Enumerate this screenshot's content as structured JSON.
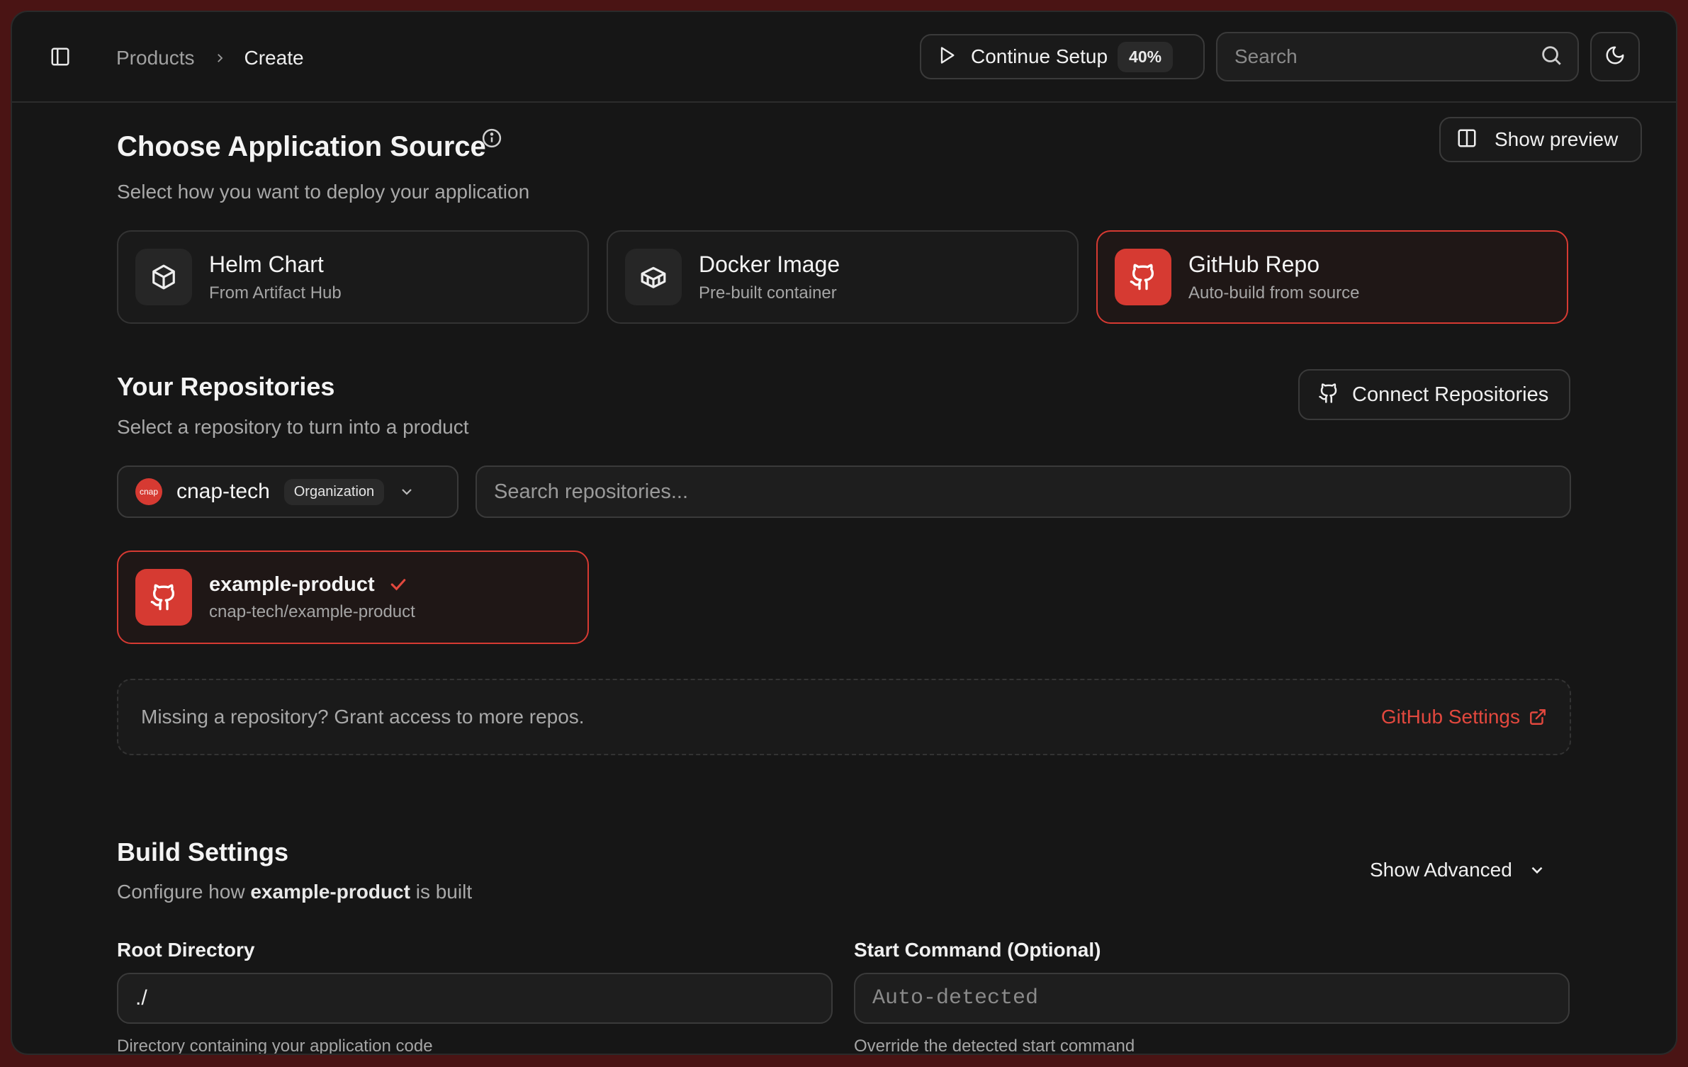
{
  "breadcrumb": {
    "parent": "Products",
    "current": "Create"
  },
  "header": {
    "continue_label": "Continue Setup",
    "continue_progress": "40%",
    "search_placeholder": "Search"
  },
  "source": {
    "title": "Choose Application Source",
    "subtitle": "Select how you want to deploy your application",
    "show_preview_label": "Show preview",
    "options": [
      {
        "title": "Helm Chart",
        "subtitle": "From Artifact Hub",
        "icon": "package-icon",
        "selected": false
      },
      {
        "title": "Docker Image",
        "subtitle": "Pre-built container",
        "icon": "container-icon",
        "selected": false
      },
      {
        "title": "GitHub Repo",
        "subtitle": "Auto-build from source",
        "icon": "github-icon",
        "selected": true
      }
    ]
  },
  "repos": {
    "title": "Your Repositories",
    "subtitle": "Select a repository to turn into a product",
    "connect_label": "Connect Repositories",
    "org": {
      "avatar_text": "cnap",
      "name": "cnap-tech",
      "badge": "Organization"
    },
    "search_placeholder": "Search repositories...",
    "selected_repo": {
      "name": "example-product",
      "path": "cnap-tech/example-product"
    },
    "missing_text": "Missing a repository? Grant access to more repos.",
    "github_settings_label": "GitHub Settings"
  },
  "build": {
    "title": "Build Settings",
    "config_prefix": "Configure how",
    "config_repo": "example-product",
    "config_suffix": "is built",
    "show_advanced_label": "Show Advanced",
    "root_dir": {
      "label": "Root Directory",
      "value": "./",
      "help": "Directory containing your application code"
    },
    "start_cmd": {
      "label": "Start Command (Optional)",
      "placeholder": "Auto-detected",
      "help": "Override the detected start command"
    }
  },
  "colors": {
    "accent": "#d63a32",
    "link": "#e2483e",
    "background": "#161616",
    "frame": "#4a1414"
  }
}
